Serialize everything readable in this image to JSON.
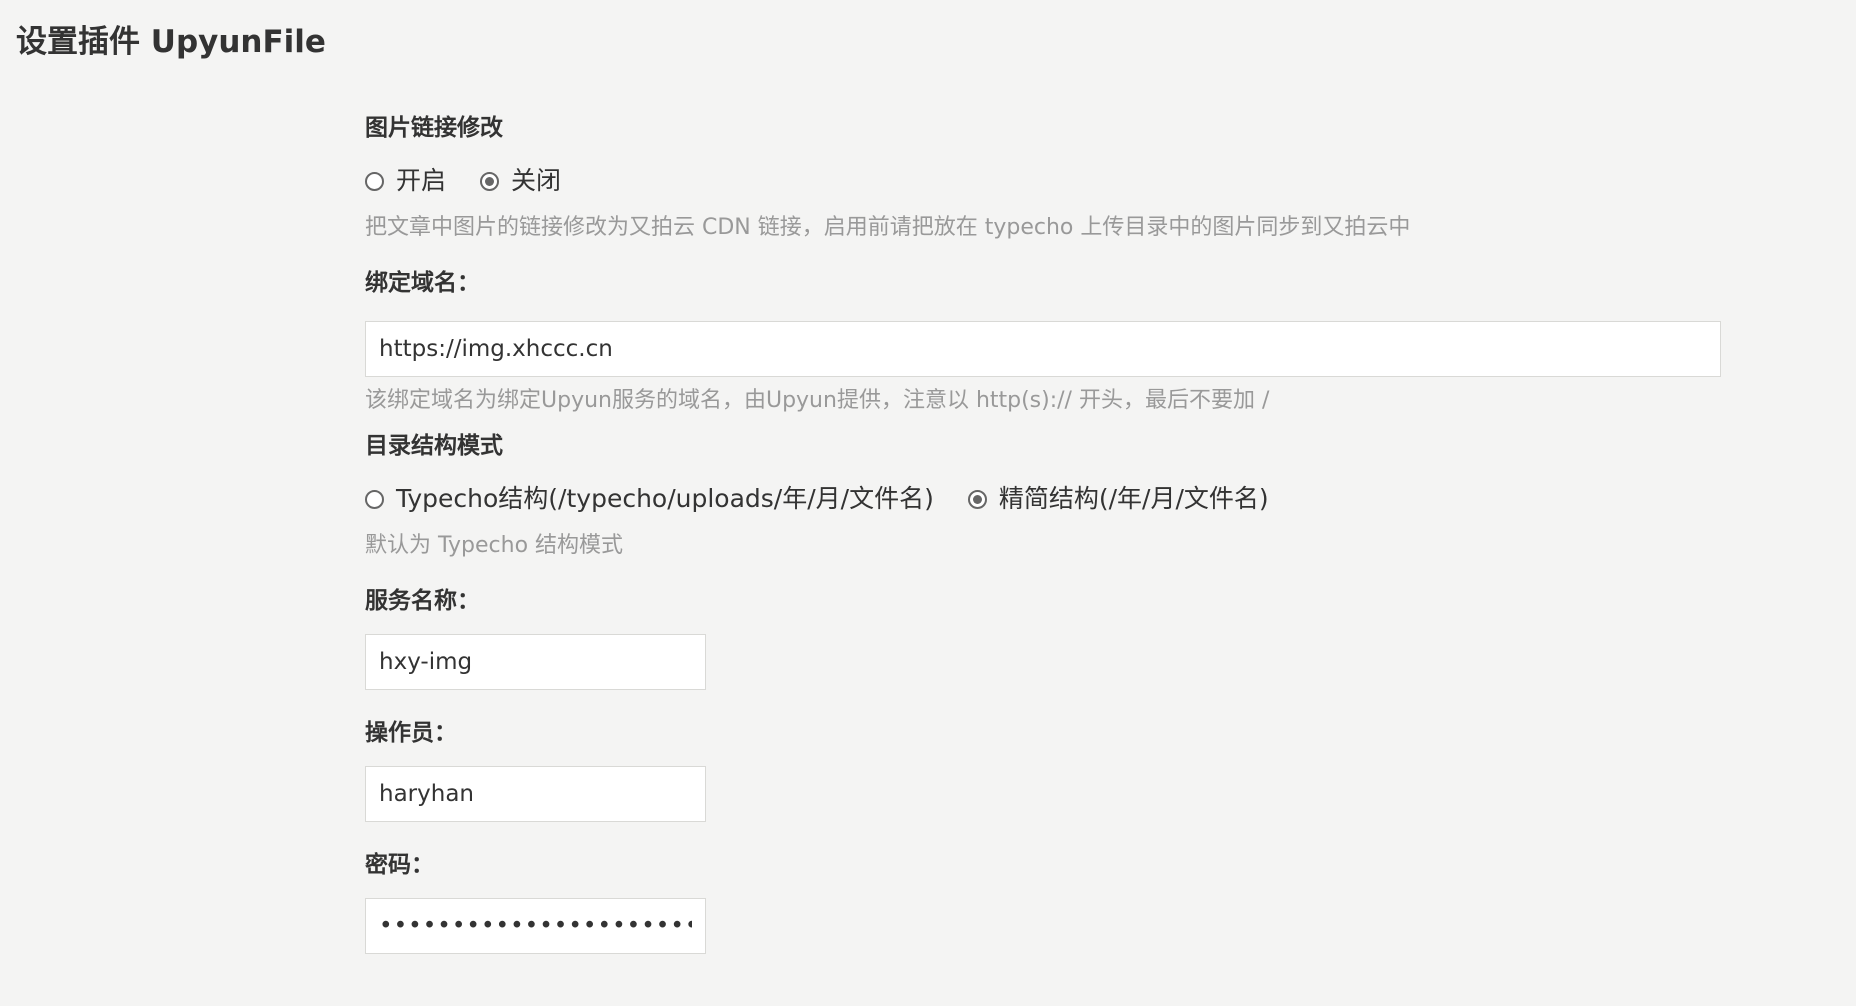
{
  "page": {
    "title": "设置插件 UpyunFile"
  },
  "form": {
    "image_link": {
      "label": "图片链接修改",
      "options": [
        {
          "label": "开启",
          "checked": false
        },
        {
          "label": "关闭",
          "checked": true
        }
      ],
      "description": "把文章中图片的链接修改为又拍云 CDN 链接，启用前请把放在 typecho 上传目录中的图片同步到又拍云中"
    },
    "domain": {
      "label": "绑定域名：",
      "value": "https://img.xhccc.cn",
      "description": "该绑定域名为绑定Upyun服务的域名，由Upyun提供，注意以 http(s):// 开头，最后不要加 /"
    },
    "directory_mode": {
      "label": "目录结构模式",
      "options": [
        {
          "label": "Typecho结构(/typecho/uploads/年/月/文件名)",
          "checked": false
        },
        {
          "label": "精简结构(/年/月/文件名)",
          "checked": true
        }
      ],
      "description": "默认为 Typecho 结构模式"
    },
    "service_name": {
      "label": "服务名称：",
      "value": "hxy-img"
    },
    "operator": {
      "label": "操作员：",
      "value": "haryhan"
    },
    "password": {
      "label": "密码：",
      "value": "••••••••••••••••••••••••••••••••"
    }
  },
  "colors": {
    "background": "#f4f4f3",
    "text": "#333333",
    "description": "#999999",
    "input_border": "#d9d9d6",
    "radio": "#666666"
  }
}
